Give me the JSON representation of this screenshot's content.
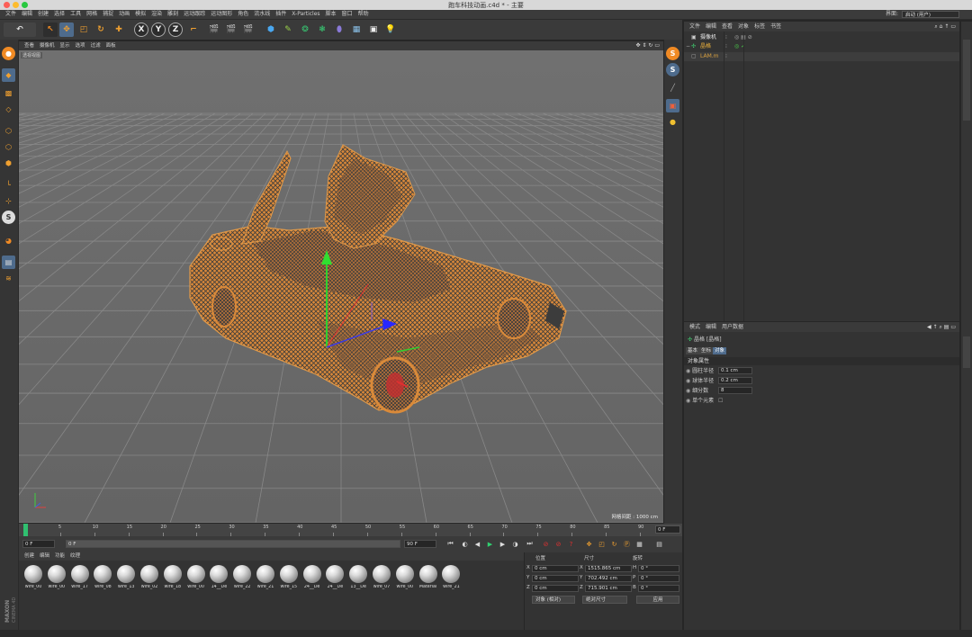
{
  "window": {
    "title": "跑车科技动画.c4d * - 主要"
  },
  "menu": [
    "文件",
    "编辑",
    "创建",
    "选择",
    "工具",
    "网格",
    "捕捉",
    "动画",
    "模拟",
    "渲染",
    "雕刻",
    "运动跟踪",
    "运动图形",
    "角色",
    "流水线",
    "插件",
    "X-Particles",
    "脚本",
    "窗口",
    "帮助"
  ],
  "layout": {
    "label": "界面:",
    "value": "启动 (用户)"
  },
  "toolbar_axes": [
    "X",
    "Y",
    "Z"
  ],
  "viewport": {
    "menu": [
      "查看",
      "摄像机",
      "显示",
      "选项",
      "过滤",
      "面板"
    ],
    "camera_label": "透视视图",
    "grid_readout": "网格间距 : 1000 cm"
  },
  "object_manager": {
    "menu": [
      "文件",
      "编辑",
      "查看",
      "对象",
      "标签",
      "书签"
    ],
    "objects": [
      {
        "name": "摄像机",
        "color": "#e8e8e8"
      },
      {
        "name": "晶格",
        "color": "#f0b43c"
      },
      {
        "name": "LAM.m",
        "color": "#d8a040"
      }
    ]
  },
  "attribute_manager": {
    "menu": [
      "模式",
      "编辑",
      "用户数据"
    ],
    "object_title": "晶格 [晶格]",
    "tabs": [
      "基本",
      "坐标",
      "对象"
    ],
    "section": "对象属性",
    "properties": [
      {
        "label": "圆柱半径",
        "value": "0.1 cm"
      },
      {
        "label": "球体半径",
        "value": "0.2 cm"
      },
      {
        "label": "细分数",
        "value": "8"
      },
      {
        "label": "单个元素",
        "value": ""
      }
    ]
  },
  "timeline": {
    "ticks": [
      "0",
      "5",
      "10",
      "15",
      "20",
      "25",
      "30",
      "35",
      "40",
      "45",
      "50",
      "55",
      "60",
      "65",
      "70",
      "75",
      "80",
      "85",
      "90"
    ],
    "end_frame": "0 F"
  },
  "playback": {
    "current": "0 F",
    "start": "0 F",
    "end": "90 F"
  },
  "material_manager": {
    "menu": [
      "创建",
      "编辑",
      "功能",
      "纹理"
    ],
    "materials": [
      "wire_00",
      "wire_00",
      "wire_17",
      "wire_08",
      "wire_13",
      "wire_02",
      "wire_18",
      "wire_00",
      "14__De",
      "wire_22",
      "wire_21",
      "wire_15",
      "24__De",
      "24__De",
      "13__De",
      "wire_07",
      "wire_00",
      "Material",
      "wire_21"
    ]
  },
  "coordinates": {
    "headers": [
      "位置",
      "尺寸",
      "旋转"
    ],
    "rows": [
      {
        "axis": "X",
        "pos": "0 cm",
        "size_axis": "X",
        "size": "1515.865 cm",
        "rot_axis": "H",
        "rot": "0 °"
      },
      {
        "axis": "Y",
        "pos": "0 cm",
        "size_axis": "Y",
        "size": "702.492 cm",
        "rot_axis": "P",
        "rot": "0 °"
      },
      {
        "axis": "Z",
        "pos": "0 cm",
        "size_axis": "Z",
        "size": "715.901 cm",
        "rot_axis": "B",
        "rot": "0 °"
      }
    ],
    "mode": "对象 (相对)",
    "size_mode": "绝对尺寸",
    "apply": "应用"
  },
  "colors": {
    "accent": "#f08a24",
    "wire": "#e8953e",
    "viewport_bg": "#6b6b6b"
  }
}
